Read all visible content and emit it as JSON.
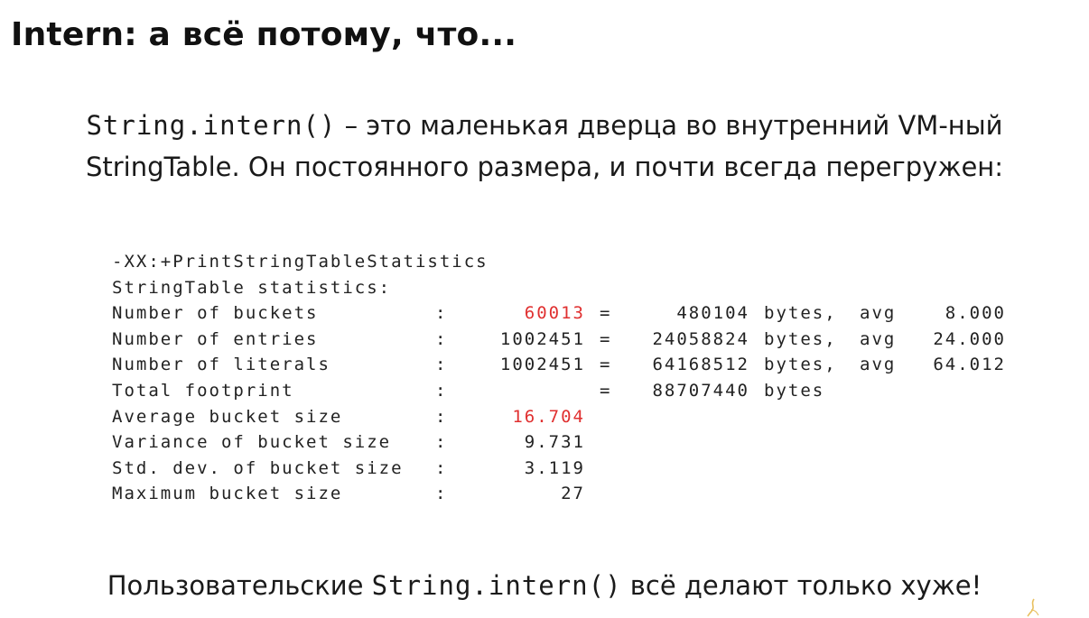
{
  "title": "Intern: а всё потому, что...",
  "intro": {
    "line1_code": "String.intern()",
    "line1_text": " – это маленькая дверца во внутренний VM-ный",
    "line2_text": "StringTable. Он постоянного размера, и почти всегда перегружен:"
  },
  "stats": {
    "flag": "-XX:+PrintStringTableStatistics",
    "header": "StringTable statistics:",
    "rows": [
      {
        "label": "Number of buckets",
        "colon": ":",
        "value": "60013",
        "eq": "=",
        "bytes": "480104",
        "unit": "bytes,",
        "avg_label": "avg",
        "avg": "8.000"
      },
      {
        "label": "Number of entries",
        "colon": ":",
        "value": "1002451",
        "eq": "=",
        "bytes": "24058824",
        "unit": "bytes,",
        "avg_label": "avg",
        "avg": "24.000"
      },
      {
        "label": "Number of literals",
        "colon": ":",
        "value": "1002451",
        "eq": "=",
        "bytes": "64168512",
        "unit": "bytes,",
        "avg_label": "avg",
        "avg": "64.012"
      },
      {
        "label": "Total footprint",
        "colon": ":",
        "value": "",
        "eq": "=",
        "bytes": "88707440",
        "unit": "bytes",
        "avg_label": "",
        "avg": ""
      },
      {
        "label": "Average bucket size",
        "colon": ":",
        "value": "16.704",
        "eq": "",
        "bytes": "",
        "unit": "",
        "avg_label": "",
        "avg": ""
      },
      {
        "label": "Variance of bucket size",
        "colon": ":",
        "value": "9.731",
        "eq": "",
        "bytes": "",
        "unit": "",
        "avg_label": "",
        "avg": ""
      },
      {
        "label": "Std. dev. of bucket size",
        "colon": ":",
        "value": "3.119",
        "eq": "",
        "bytes": "",
        "unit": "",
        "avg_label": "",
        "avg": ""
      },
      {
        "label": "Maximum bucket size",
        "colon": ":",
        "value": "27",
        "eq": "",
        "bytes": "",
        "unit": "",
        "avg_label": "",
        "avg": ""
      }
    ],
    "highlight_color": "#e03030"
  },
  "footer": {
    "before": "Пользовательские ",
    "code": "String.intern()",
    "after": " всё делают только хуже!"
  }
}
